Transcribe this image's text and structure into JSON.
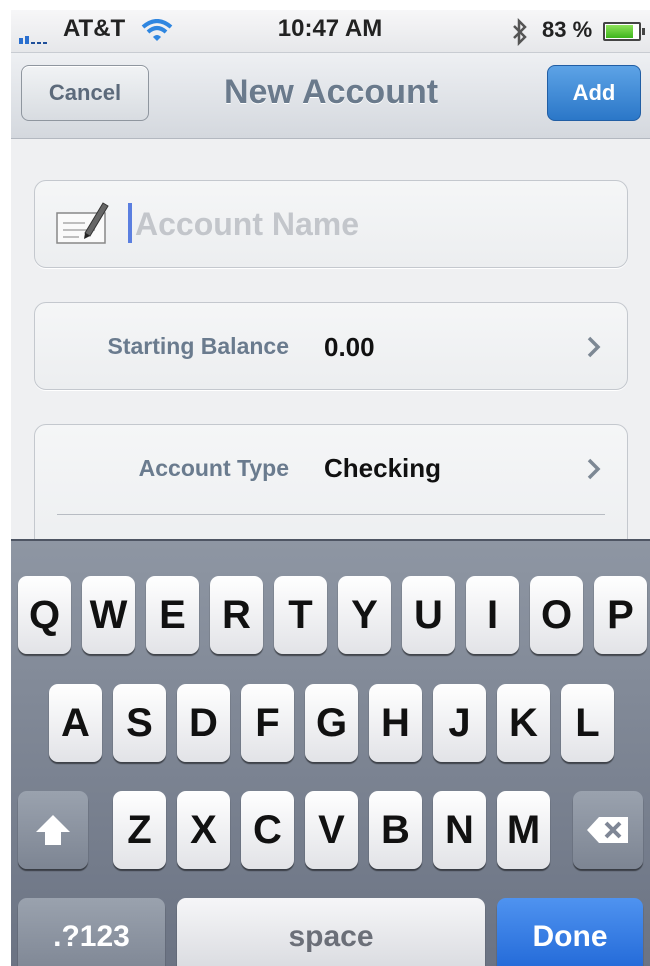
{
  "status_bar": {
    "carrier": "AT&T",
    "time": "10:47 AM",
    "battery": "83 %",
    "battery_level": 0.83,
    "icons": [
      "signal-icon",
      "wifi-icon",
      "bluetooth-icon",
      "battery-icon"
    ]
  },
  "nav": {
    "cancel_label": "Cancel",
    "title": "New Account",
    "add_label": "Add"
  },
  "form": {
    "account_name": {
      "placeholder": "Account Name",
      "value": "",
      "icon": "edit-check-icon"
    },
    "starting_balance": {
      "label": "Starting Balance",
      "value": "0.00"
    },
    "account_type": {
      "label": "Account Type",
      "value": "Checking"
    }
  },
  "keyboard": {
    "row1": [
      "Q",
      "W",
      "E",
      "R",
      "T",
      "Y",
      "U",
      "I",
      "O",
      "P"
    ],
    "row2": [
      "A",
      "S",
      "D",
      "F",
      "G",
      "H",
      "J",
      "K",
      "L"
    ],
    "row3": [
      "Z",
      "X",
      "C",
      "V",
      "B",
      "N",
      "M"
    ],
    "numbers_label": ".?123",
    "space_label": "space",
    "done_label": "Done",
    "icons": [
      "shift-icon",
      "backspace-icon"
    ]
  },
  "colors": {
    "accent_blue": "#2b77c8",
    "done_blue": "#1f66d6",
    "label_gray": "#6a7b8e"
  }
}
